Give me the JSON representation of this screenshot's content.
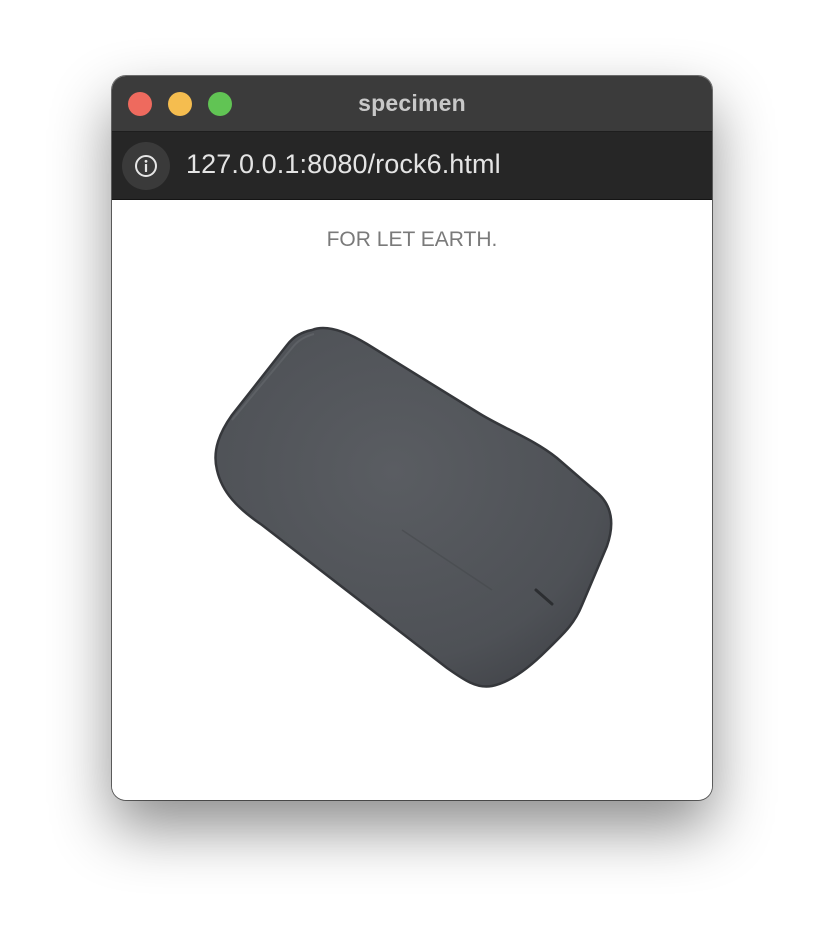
{
  "window": {
    "title": "specimen"
  },
  "address_bar": {
    "url": "127.0.0.1:8080/rock6.html",
    "info_icon": "info-icon"
  },
  "page": {
    "caption": "FOR LET EARTH."
  },
  "colors": {
    "close": "#ee6a5e",
    "minimize": "#f5bd4f",
    "maximize": "#61c454",
    "rock": "#4e5156"
  }
}
